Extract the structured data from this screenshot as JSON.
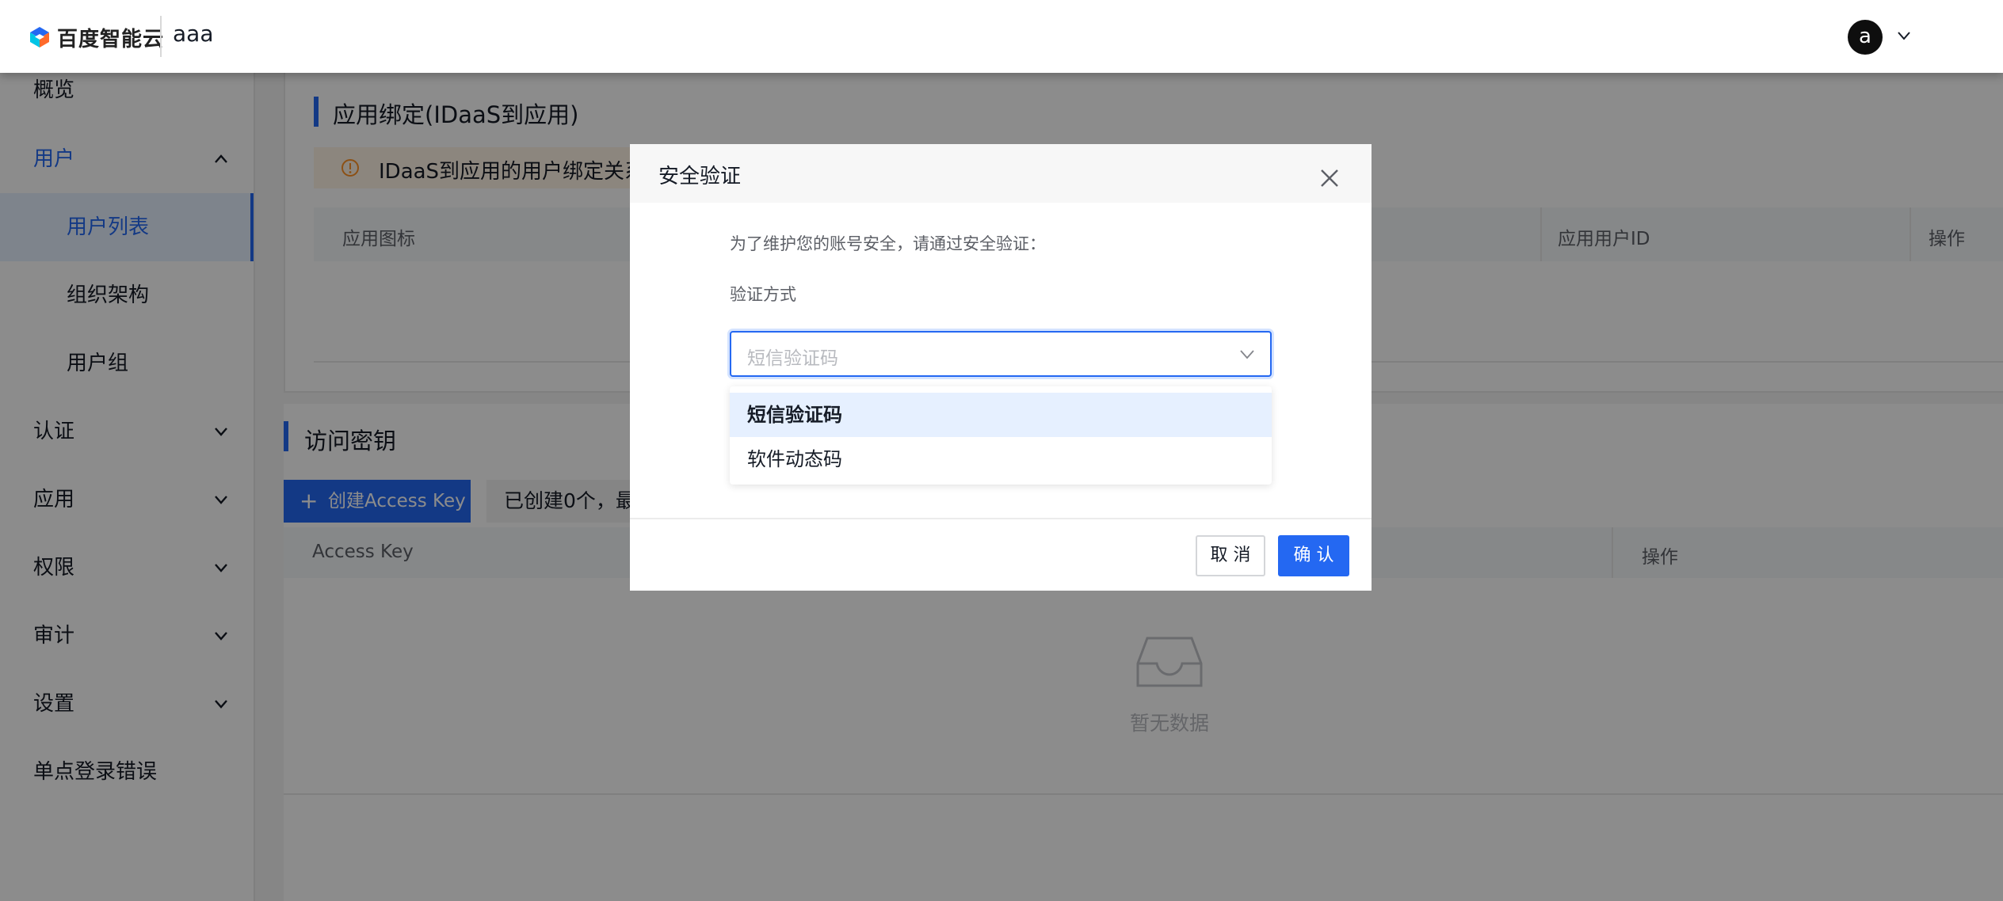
{
  "header": {
    "brand": "百度智能云",
    "tenant": "aaa",
    "avatar_letter": "a"
  },
  "sidebar": {
    "items": [
      {
        "label": "概览"
      },
      {
        "label": "用户"
      },
      {
        "label": "用户列表"
      },
      {
        "label": "组织架构"
      },
      {
        "label": "用户组"
      },
      {
        "label": "认证"
      },
      {
        "label": "应用"
      },
      {
        "label": "权限"
      },
      {
        "label": "审计"
      },
      {
        "label": "设置"
      },
      {
        "label": "单点登录错误"
      }
    ]
  },
  "main": {
    "binding": {
      "title": "应用绑定(IDaaS到应用)",
      "alert": "IDaaS到应用的用户绑定关系",
      "columns": [
        "应用图标",
        "应用用户ID",
        "操作"
      ]
    },
    "access_key": {
      "title": "访问密钥",
      "create_button": "创建Access Key",
      "count_text": "已创建0个，最",
      "columns": [
        "Access Key",
        "操作"
      ],
      "empty_text": "暂无数据"
    }
  },
  "modal": {
    "title": "安全验证",
    "description": "为了维护您的账号安全，请通过安全验证：",
    "field_label": "验证方式",
    "select_placeholder": "短信验证码",
    "options": [
      "短信验证码",
      "软件动态码"
    ],
    "cancel_label": "取 消",
    "confirm_label": "确 认"
  },
  "colors": {
    "accent": "#2468f2",
    "mask": "rgba(0,0,0,0.45)"
  }
}
